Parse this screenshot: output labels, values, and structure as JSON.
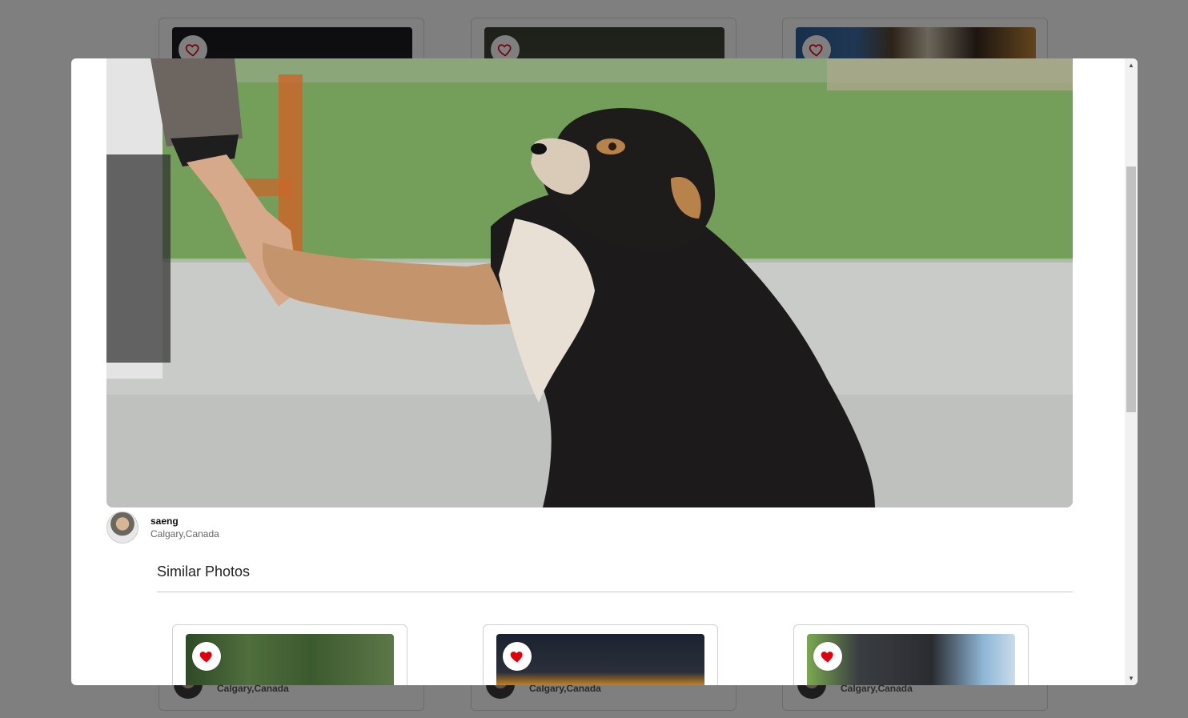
{
  "background_grid": {
    "cards": [
      {
        "location": "Calgary,Canada"
      },
      {
        "location": "Calgary,Canada"
      },
      {
        "location": "Calgary,Canada"
      }
    ]
  },
  "modal": {
    "author": {
      "name": "saeng",
      "location": "Calgary,Canada"
    },
    "similar_section_title": "Similar Photos",
    "similar_photos": [
      {
        "liked": true
      },
      {
        "liked": true
      },
      {
        "liked": true
      }
    ]
  },
  "colors": {
    "heart_red": "#e0000b",
    "overlay": "rgba(0,0,0,0.5)"
  },
  "icons": {
    "heart_outline": "heart-outline-icon",
    "heart_filled": "heart-filled-icon",
    "scroll_up": "▲",
    "scroll_down": "▼"
  }
}
